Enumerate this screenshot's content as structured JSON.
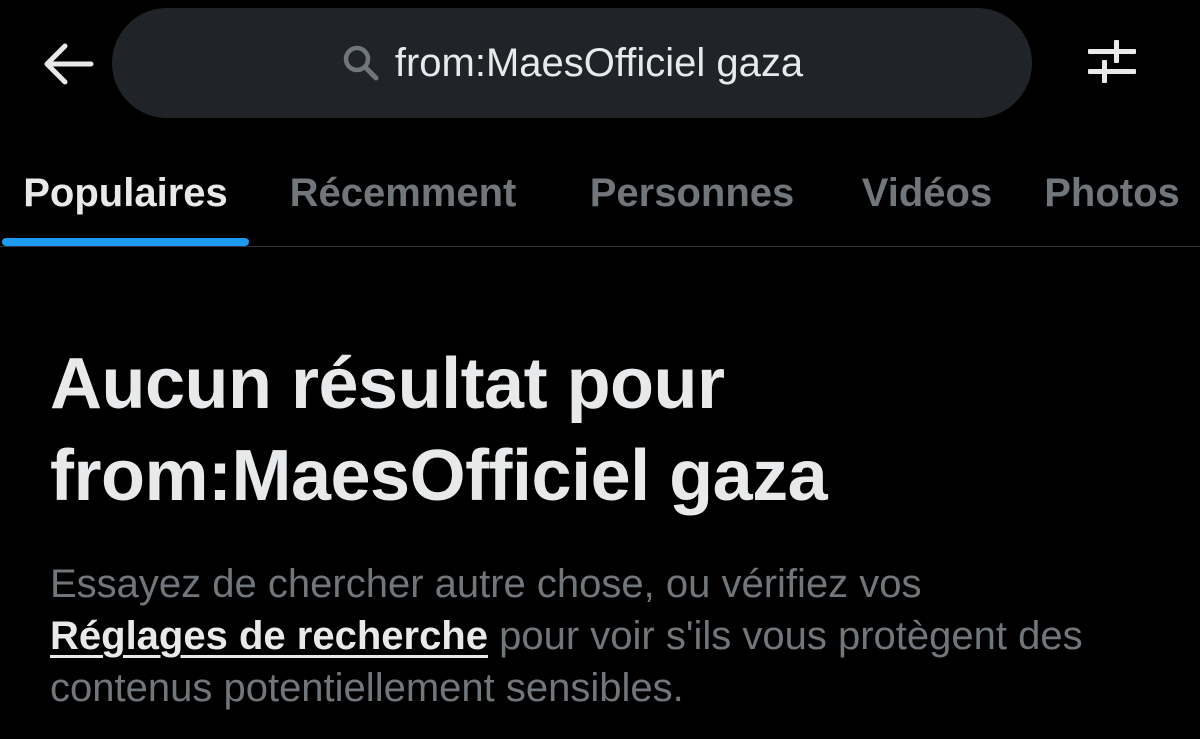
{
  "header": {
    "back_icon": "arrow-left-icon",
    "search": {
      "icon": "search-icon",
      "query": "from:MaesOfficiel gaza"
    },
    "filter_icon": "sliders-icon"
  },
  "tabs": [
    {
      "label": "Populaires",
      "active": true
    },
    {
      "label": "Récemment",
      "active": false
    },
    {
      "label": "Personnes",
      "active": false
    },
    {
      "label": "Vidéos",
      "active": false
    },
    {
      "label": "Photos",
      "active": false
    }
  ],
  "empty_state": {
    "title_line1": "Aucun résultat pour",
    "title_line2": "from:MaesOfficiel gaza",
    "body_before_link": "Essayez de chercher autre chose, ou vérifiez vos",
    "link_label": "Réglages de recherche",
    "body_after_link": "pour voir s'ils vous protègent des contenus potentiellement sensibles."
  },
  "colors": {
    "background": "#000000",
    "primary_text": "#e7e9ea",
    "secondary_text": "#71767b",
    "search_bg": "#202327",
    "accent": "#1d9bf0",
    "divider": "#2f3336"
  }
}
